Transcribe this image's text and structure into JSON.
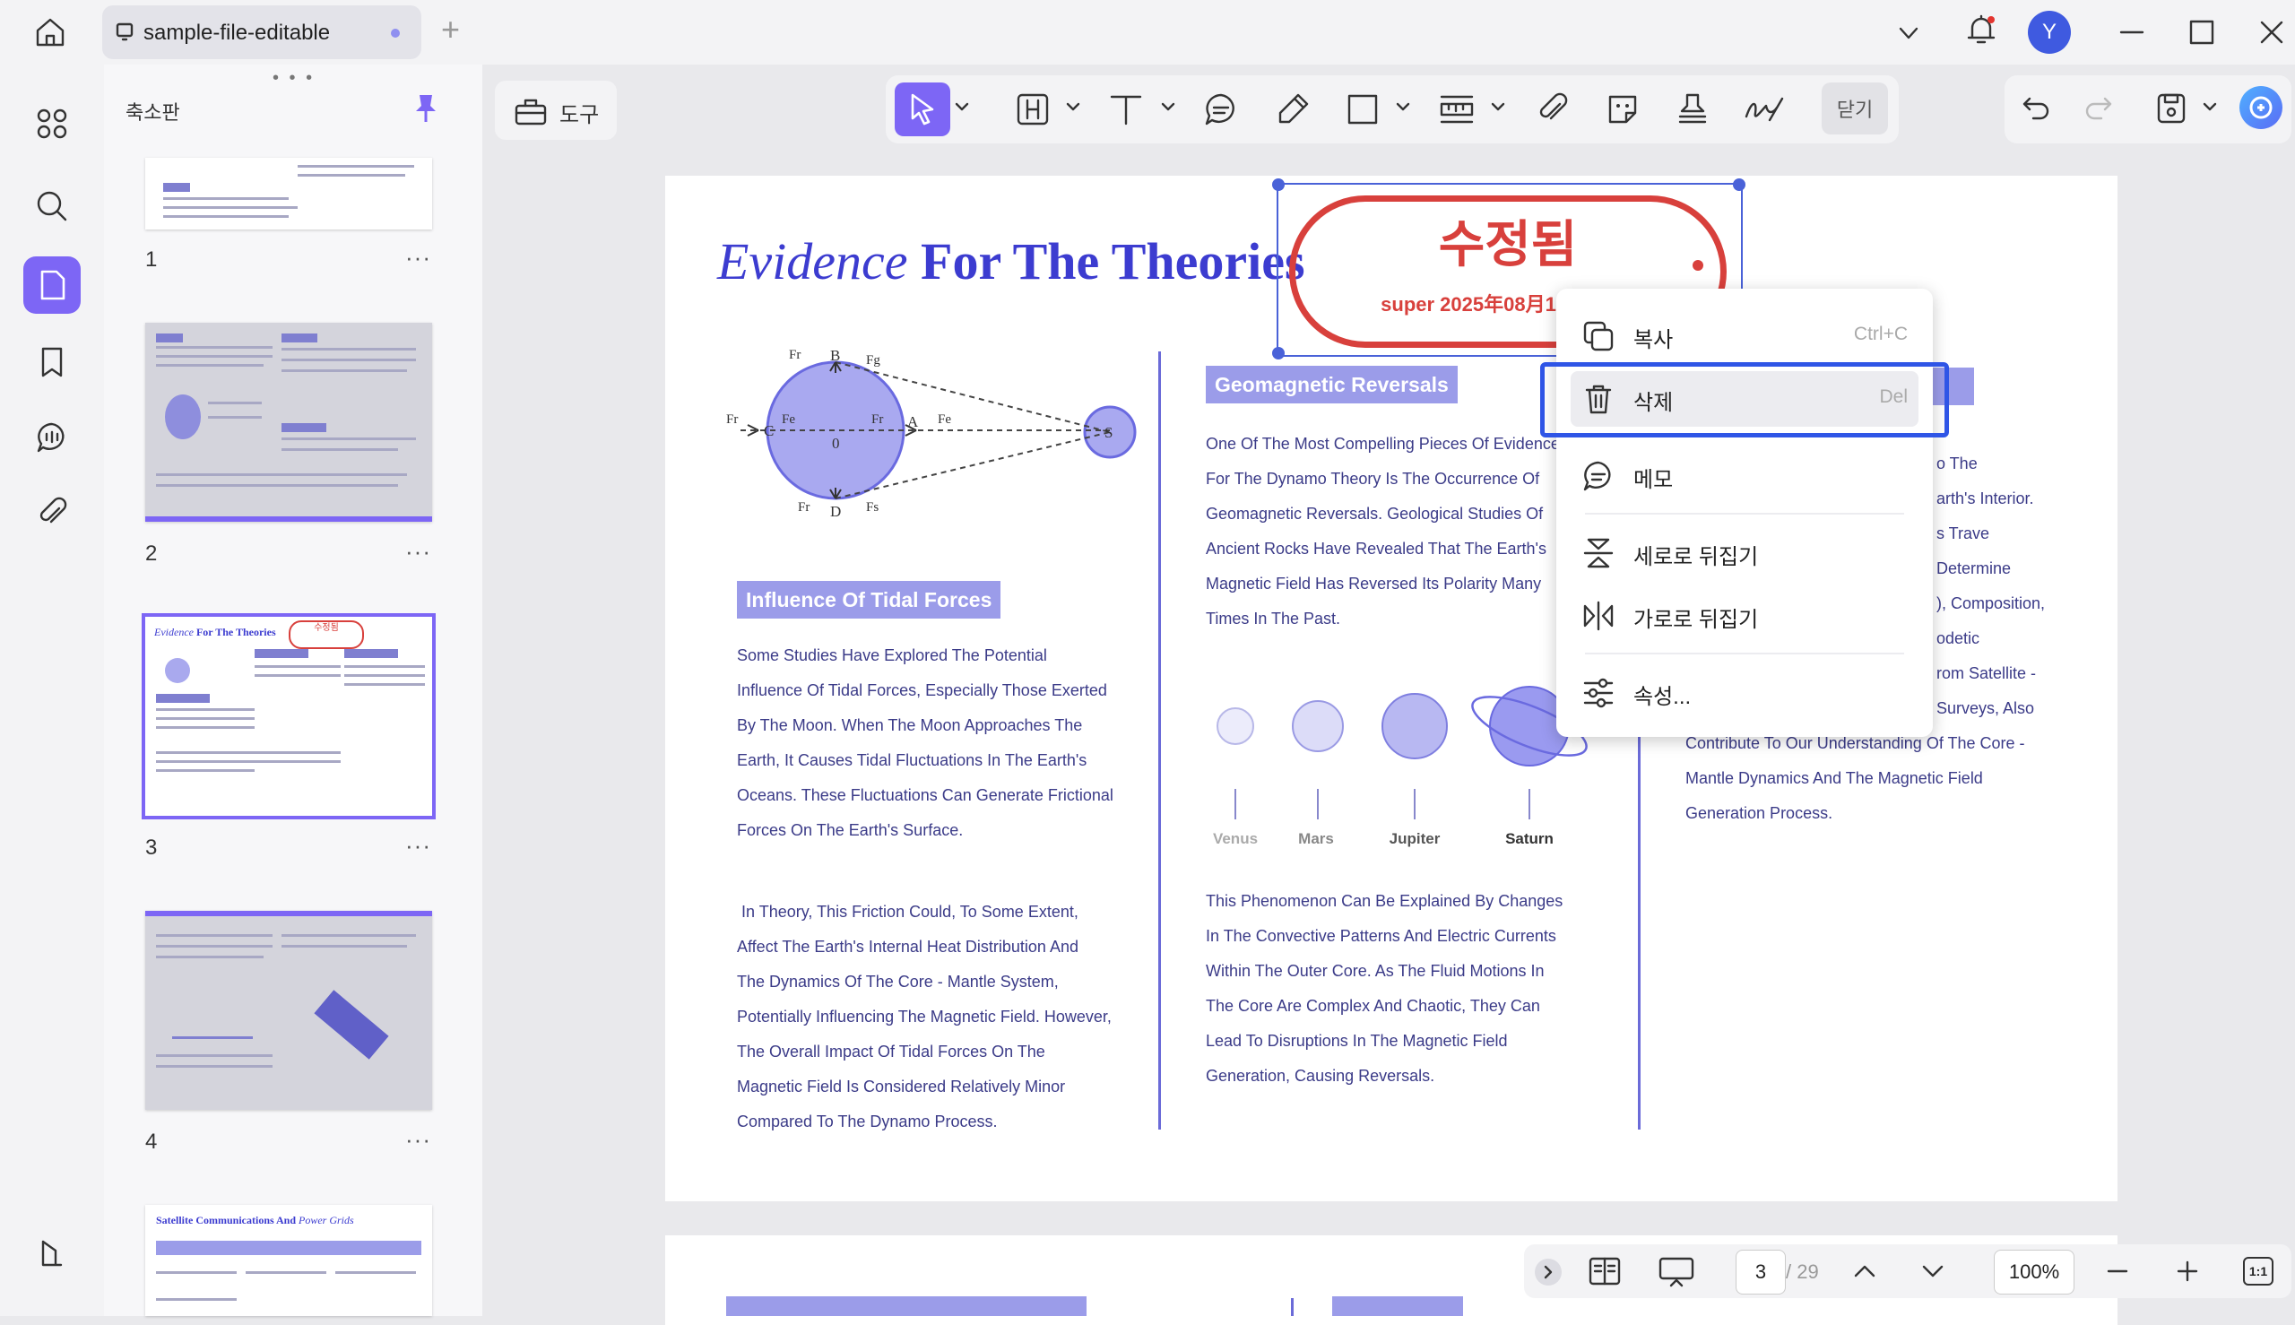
{
  "titlebar": {
    "tab_title": "sample-file-editable",
    "new_tab": "+",
    "avatar_initial": "Y"
  },
  "sidebar": {
    "title": "축소판",
    "pages": [
      {
        "number": "1",
        "more": "···"
      },
      {
        "number": "2",
        "more": "···"
      },
      {
        "number": "3",
        "more": "···"
      },
      {
        "number": "4",
        "more": "···"
      }
    ],
    "thumb5_title": "Satellite Communications And",
    "thumb5_title_italic": "Power Grids",
    "thumb3_stamp": "수정됨"
  },
  "toolbar": {
    "tools_label": "도구",
    "close_label": "닫기"
  },
  "document": {
    "title_italic": "Evidence",
    "title_bold": "For The Theories",
    "section_tidal": "Influence Of Tidal Forces",
    "tidal_p1": [
      "Some Studies Have Explored The Potential",
      "Influence Of Tidal Forces, Especially Those Exerted",
      "By The Moon. When The Moon Approaches The",
      "Earth, It Causes Tidal Fluctuations In The Earth's",
      "Oceans. These Fluctuations Can Generate Frictional",
      "Forces On The Earth's Surface."
    ],
    "tidal_p2": [
      "In Theory, This Friction Could, To Some Extent,",
      "Affect The Earth's Internal Heat Distribution And",
      "The Dynamics Of The Core - Mantle System,",
      "Potentially Influencing The Magnetic Field. However,",
      "The Overall Impact Of Tidal Forces On The",
      "Magnetic Field Is Considered Relatively Minor",
      "Compared To The Dynamo Process."
    ],
    "section_geo": "Geomagnetic Reversals",
    "geo_p1": [
      "One Of The Most Compelling Pieces Of Evidence",
      "For The Dynamo Theory Is The Occurrence Of",
      "Geomagnetic Reversals. Geological Studies Of",
      "Ancient Rocks Have Revealed That The Earth's",
      "Magnetic Field Has Reversed Its Polarity Many",
      "Times In The Past."
    ],
    "planets": [
      "Venus",
      "Mars",
      "Jupiter",
      "Saturn"
    ],
    "geo_p2": [
      "This Phenomenon Can Be Explained By Changes",
      "In The Convective Patterns And Electric Currents",
      "Within The Outer Core. As The Fluid Motions In",
      "The Core Are Complex And Chaotic, They Can",
      "Lead To Disruptions In The Magnetic Field",
      "Generation, Causing Reversals."
    ],
    "right_col_fragments": [
      "o The",
      "arth's Interior.",
      "s Trave",
      "Determine",
      "), Composition,",
      "odetic",
      "rom Satellite -",
      "Surveys, Also"
    ],
    "right_col_lines": [
      "Contribute To Our Understanding Of The Core -",
      "Mantle Dynamics And The Magnetic Field",
      "Generation Process."
    ],
    "diagram_labels": {
      "b": "B",
      "c": "C",
      "d": "D",
      "a": "A",
      "o": "0",
      "s": "S",
      "fr": "Fr",
      "fe": "Fe",
      "fs": "Fs",
      "fg": "Fg"
    }
  },
  "stamp": {
    "main": "수정됨",
    "sub": "super 2025年08月1"
  },
  "context_menu": {
    "items": [
      {
        "label": "복사",
        "shortcut": "Ctrl+C",
        "icon": "copy-icon"
      },
      {
        "label": "삭제",
        "shortcut": "Del",
        "icon": "trash-icon"
      },
      {
        "label": "메모",
        "shortcut": "",
        "icon": "comment-icon"
      },
      {
        "label": "세로로 뒤집기",
        "shortcut": "",
        "icon": "flip-vertical-icon"
      },
      {
        "label": "가로로 뒤집기",
        "shortcut": "",
        "icon": "flip-horizontal-icon"
      },
      {
        "label": "속성...",
        "shortcut": "",
        "icon": "properties-icon"
      }
    ]
  },
  "bottom_nav": {
    "current_page": "3",
    "total_pages": "/ 29",
    "zoom": "100%",
    "fit_label": "1:1"
  },
  "colors": {
    "accent": "#7d66f5",
    "doc_blue": "#3c3cd0",
    "stamp_red": "#d8403c",
    "highlight_blue": "#2f55e6"
  }
}
